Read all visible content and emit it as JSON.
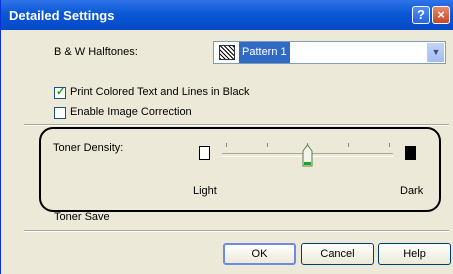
{
  "dialog": {
    "title": "Detailed Settings",
    "help_button": "?",
    "close_button": "×"
  },
  "halftones": {
    "label": "B & W Halftones:",
    "selected": "Pattern 1",
    "icon": "pattern-icon"
  },
  "options": [
    {
      "label": "Print Colored Text and Lines in Black",
      "checked": true
    },
    {
      "label": "Enable Image Correction",
      "checked": false
    }
  ],
  "toner": {
    "label": "Toner Density:",
    "min_label": "Light",
    "max_label": "Dark",
    "level": 0.6,
    "ticks": 5
  },
  "partially_hidden": {
    "label": "Toner Save"
  },
  "buttons": {
    "ok": "OK",
    "cancel": "Cancel",
    "help": "Help"
  }
}
